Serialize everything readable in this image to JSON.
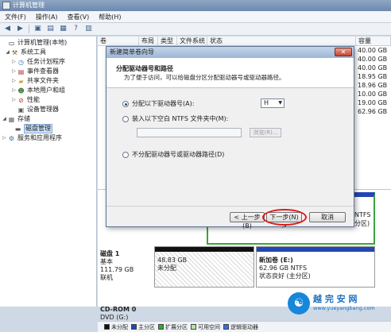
{
  "window": {
    "title": "计算机管理"
  },
  "menu": [
    "文件(F)",
    "操作(A)",
    "查看(V)",
    "帮助(H)"
  ],
  "tree": {
    "items": [
      {
        "label": "计算机管理(本地)",
        "icon": "computer-icon",
        "level": 0,
        "twisty": ""
      },
      {
        "label": "系统工具",
        "icon": "tools-icon",
        "level": 1,
        "twisty": "◢"
      },
      {
        "label": "任务计划程序",
        "icon": "clock-icon",
        "level": 2,
        "twisty": "▷"
      },
      {
        "label": "事件查看器",
        "icon": "log-icon",
        "level": 2,
        "twisty": "▷"
      },
      {
        "label": "共享文件夹",
        "icon": "folder-icon",
        "level": 2,
        "twisty": "▷"
      },
      {
        "label": "本地用户和组",
        "icon": "users-icon",
        "level": 2,
        "twisty": "▷"
      },
      {
        "label": "性能",
        "icon": "performance-icon",
        "level": 2,
        "twisty": "▷"
      },
      {
        "label": "设备管理器",
        "icon": "device-icon",
        "level": 2,
        "twisty": ""
      },
      {
        "label": "存储",
        "icon": "storage-icon",
        "level": 1,
        "twisty": "◢"
      },
      {
        "label": "磁盘管理",
        "icon": "disk-icon",
        "level": 2,
        "twisty": ""
      },
      {
        "label": "服务和应用程序",
        "icon": "services-icon",
        "level": 1,
        "twisty": "▷"
      }
    ]
  },
  "list": {
    "columns": [
      "卷",
      "布局",
      "类型",
      "文件系统",
      "状态",
      "容量"
    ],
    "capacities": [
      "40.00 GB",
      "40.00 GB",
      "40.00 GB",
      "18.95 GB",
      "18.96 GB",
      "10.00 GB",
      "19.00 GB",
      "62.96 GB"
    ]
  },
  "disks": {
    "disk1": {
      "name": "磁盘 1",
      "type": "基本",
      "size": "111.79 GB",
      "status": "联机"
    },
    "unalloc": {
      "size": "48.83 GB",
      "label": "未分配"
    },
    "newvol": {
      "name": "新加卷  (E:)",
      "info": "62.96 GB NTFS",
      "status": "状态良好 (主分区)"
    },
    "ntfs_side": [
      "NTFS",
      "分区)"
    ],
    "cdrom": {
      "name": "CD-ROM 0",
      "type": "DVD (G:)"
    }
  },
  "legend": [
    {
      "label": "未分配",
      "color": "#111111"
    },
    {
      "label": "主分区",
      "color": "#2445b5"
    },
    {
      "label": "扩展分区",
      "color": "#3ba53b"
    },
    {
      "label": "可用空间",
      "color": "#b6e3a8"
    },
    {
      "label": "逻辑驱动器",
      "color": "#3b6fe0"
    }
  ],
  "dialog": {
    "title": "新建简单卷向导",
    "close": "✕",
    "header": "分配驱动器号和路径",
    "subheader": "为了便于访问，可以给磁盘分区分配驱动器号或驱动器路径。",
    "option1": "分配以下驱动器号(A):",
    "drive_letter": "H",
    "option2": "装入以下空白 NTFS 文件夹中(M):",
    "browse": "浏览(R)...",
    "option3": "不分配驱动器号或驱动器路径(D)",
    "back": "< 上一步(B)",
    "next": "下一步(N) >",
    "cancel": "取消"
  },
  "watermark": {
    "name": "越 完 安 网",
    "url": "www.yueyangbang.com"
  }
}
